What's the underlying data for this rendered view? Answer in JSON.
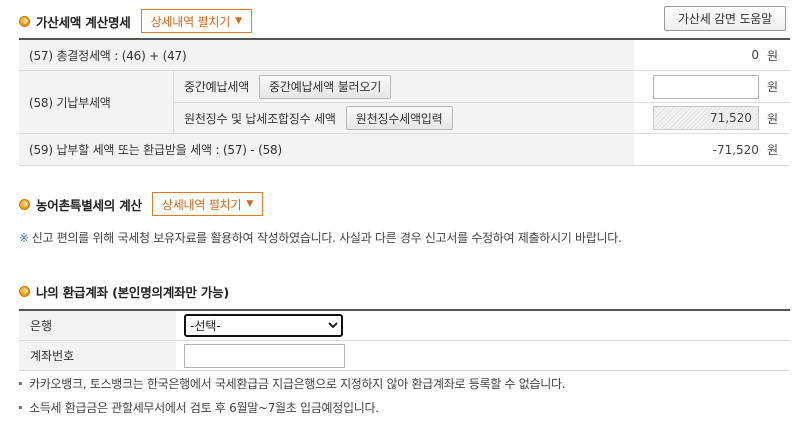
{
  "tax_section": {
    "title": "가산세액 계산명세",
    "expand_label": "상세내역 펼치기",
    "help_button": "가산세 감면 도움말",
    "rows": {
      "total": {
        "label": "(57) 총결정세액 : (46) + (47)",
        "value": "0",
        "unit": "원"
      },
      "paid": {
        "label": "(58) 기납부세액",
        "interim": {
          "label": "중간예납세액",
          "button": "중간예납세액 불러오기",
          "value": "",
          "unit": "원"
        },
        "withholding": {
          "label": "원천징수 및 납세조합징수 세액",
          "button": "원천징수세액입력",
          "value": "71,520",
          "unit": "원"
        }
      },
      "payable": {
        "label": "(59) 납부할 세액 또는 환급받을 세액 : (57) - (58)",
        "value": "-71,520",
        "unit": "원"
      }
    }
  },
  "rural_section": {
    "title": "농어촌특별세의 계산",
    "expand_label": "상세내역 펼치기"
  },
  "notice": {
    "mark": "※",
    "text": "신고 편의를 위해 국세청 보유자료를 활용하여 작성하였습니다. 사실과 다른 경우 신고서를 수정하여 제출하시기 바랍니다."
  },
  "refund_section": {
    "title": "나의 환급계좌 (본인명의계좌만 가능)",
    "bank_label": "은행",
    "bank_selected": "-선택-",
    "account_label": "계좌번호",
    "account_value": ""
  },
  "notes": [
    "카카오뱅크, 토스뱅크는 한국은행에서 국세환급금 지급은행으로 지정하지 않아 환급계좌로 등록할 수 없습니다.",
    "소득세 환급금은 관할세무서에서 검토 후 6월말~7월초 입금예정입니다."
  ]
}
